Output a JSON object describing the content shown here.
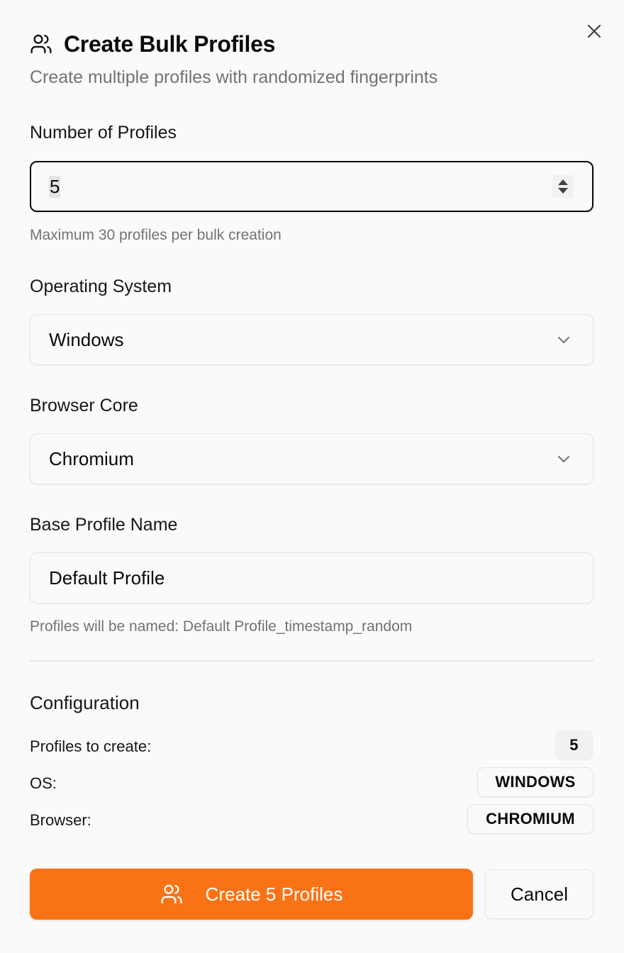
{
  "dialog": {
    "title": "Create Bulk Profiles",
    "title_icon": "users-icon",
    "subtitle": "Create multiple profiles with randomized fingerprints",
    "close_icon": "close-icon"
  },
  "form": {
    "count": {
      "label": "Number of Profiles",
      "value": "5",
      "hint": "Maximum 30 profiles per bulk creation"
    },
    "os": {
      "label": "Operating System",
      "value": "Windows"
    },
    "browser": {
      "label": "Browser Core",
      "value": "Chromium"
    },
    "base_name": {
      "label": "Base Profile Name",
      "value": "Default Profile",
      "hint": "Profiles will be named: Default Profile_timestamp_random"
    }
  },
  "configuration": {
    "title": "Configuration",
    "profiles_label": "Profiles to create:",
    "profiles_value": "5",
    "os_label": "OS:",
    "os_value": "WINDOWS",
    "browser_label": "Browser:",
    "browser_value": "CHROMIUM"
  },
  "actions": {
    "create_label": "Create 5 Profiles",
    "create_icon": "users-icon",
    "cancel_label": "Cancel"
  },
  "colors": {
    "accent": "#f97316",
    "background": "#fafafa",
    "muted_text": "#737373",
    "border": "#e5e5e5"
  }
}
